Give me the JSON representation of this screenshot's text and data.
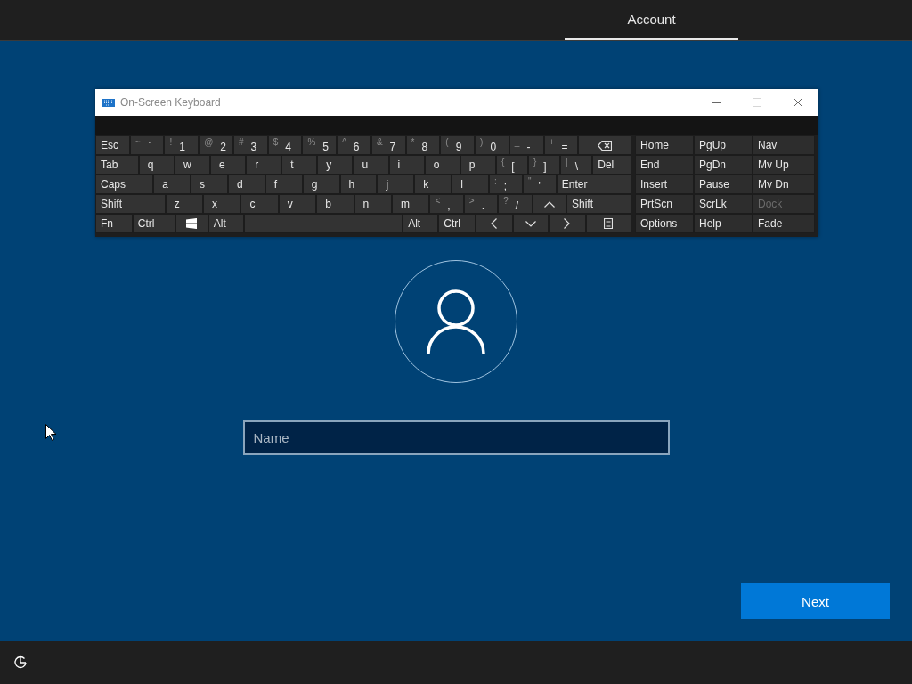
{
  "top_bar": {
    "tabs": [
      {
        "label": "Account",
        "selected": true
      }
    ]
  },
  "keyboard": {
    "title": "On-Screen Keyboard",
    "window_controls": [
      {
        "kind": "minimize",
        "disabled": false
      },
      {
        "kind": "maximize",
        "disabled": true
      },
      {
        "kind": "close",
        "disabled": false
      }
    ],
    "rows": [
      [
        {
          "kind": "key",
          "label": "Esc"
        },
        {
          "kind": "dual",
          "shift": "~",
          "main": "`"
        },
        {
          "kind": "dual",
          "shift": "!",
          "main": "1"
        },
        {
          "kind": "dual",
          "shift": "@",
          "main": "2"
        },
        {
          "kind": "dual",
          "shift": "#",
          "main": "3"
        },
        {
          "kind": "dual",
          "shift": "$",
          "main": "4"
        },
        {
          "kind": "dual",
          "shift": "%",
          "main": "5"
        },
        {
          "kind": "dual",
          "shift": "^",
          "main": "6"
        },
        {
          "kind": "dual",
          "shift": "&",
          "main": "7"
        },
        {
          "kind": "dual",
          "shift": "*",
          "main": "8"
        },
        {
          "kind": "dual",
          "shift": "(",
          "main": "9"
        },
        {
          "kind": "dual",
          "shift": ")",
          "main": "0"
        },
        {
          "kind": "dual",
          "shift": "_",
          "main": "-"
        },
        {
          "kind": "dual",
          "shift": "+",
          "main": "="
        },
        {
          "kind": "backspace"
        }
      ],
      [
        {
          "kind": "tab",
          "label": "Tab"
        },
        {
          "kind": "letter",
          "label": "q"
        },
        {
          "kind": "letter",
          "label": "w"
        },
        {
          "kind": "letter",
          "label": "e"
        },
        {
          "kind": "letter",
          "label": "r"
        },
        {
          "kind": "letter",
          "label": "t"
        },
        {
          "kind": "letter",
          "label": "y"
        },
        {
          "kind": "letter",
          "label": "u"
        },
        {
          "kind": "letter",
          "label": "i"
        },
        {
          "kind": "letter",
          "label": "o"
        },
        {
          "kind": "letter",
          "label": "p"
        },
        {
          "kind": "dual",
          "shift": "{",
          "main": "["
        },
        {
          "kind": "dual",
          "shift": "}",
          "main": "]"
        },
        {
          "kind": "dual",
          "shift": "|",
          "main": "\\"
        },
        {
          "kind": "del",
          "label": "Del"
        }
      ],
      [
        {
          "kind": "caps",
          "label": "Caps"
        },
        {
          "kind": "letter",
          "label": "a"
        },
        {
          "kind": "letter",
          "label": "s"
        },
        {
          "kind": "letter",
          "label": "d"
        },
        {
          "kind": "letter",
          "label": "f"
        },
        {
          "kind": "letter",
          "label": "g"
        },
        {
          "kind": "letter",
          "label": "h"
        },
        {
          "kind": "letter",
          "label": "j"
        },
        {
          "kind": "letter",
          "label": "k"
        },
        {
          "kind": "letter",
          "label": "l"
        },
        {
          "kind": "dual",
          "shift": ":",
          "main": ";"
        },
        {
          "kind": "dual",
          "shift": "\"",
          "main": "'"
        },
        {
          "kind": "enter",
          "label": "Enter"
        }
      ],
      [
        {
          "kind": "lshift",
          "label": "Shift"
        },
        {
          "kind": "letter",
          "label": "z"
        },
        {
          "kind": "letter",
          "label": "x"
        },
        {
          "kind": "letter",
          "label": "c"
        },
        {
          "kind": "letter",
          "label": "v"
        },
        {
          "kind": "letter",
          "label": "b"
        },
        {
          "kind": "letter",
          "label": "n"
        },
        {
          "kind": "letter",
          "label": "m"
        },
        {
          "kind": "dual",
          "shift": "<",
          "main": ","
        },
        {
          "kind": "dual",
          "shift": ">",
          "main": "."
        },
        {
          "kind": "dual",
          "shift": "?",
          "main": "/"
        },
        {
          "kind": "up"
        },
        {
          "kind": "rshift",
          "label": "Shift"
        }
      ],
      [
        {
          "kind": "key",
          "label": "Fn"
        },
        {
          "kind": "ctrl",
          "label": "Ctrl"
        },
        {
          "kind": "win"
        },
        {
          "kind": "alt",
          "label": "Alt"
        },
        {
          "kind": "space"
        },
        {
          "kind": "alt",
          "label": "Alt"
        },
        {
          "kind": "key",
          "label": "Ctrl"
        },
        {
          "kind": "left"
        },
        {
          "kind": "down"
        },
        {
          "kind": "right"
        },
        {
          "kind": "menu"
        }
      ]
    ],
    "nav_rows": [
      [
        {
          "label": "Home",
          "disabled": false
        },
        {
          "label": "PgUp",
          "disabled": false
        },
        {
          "label": "Nav",
          "disabled": false
        }
      ],
      [
        {
          "label": "End",
          "disabled": false
        },
        {
          "label": "PgDn",
          "disabled": false
        },
        {
          "label": "Mv Up",
          "disabled": false
        }
      ],
      [
        {
          "label": "Insert",
          "disabled": false
        },
        {
          "label": "Pause",
          "disabled": false
        },
        {
          "label": "Mv Dn",
          "disabled": false
        }
      ],
      [
        {
          "label": "PrtScn",
          "disabled": false
        },
        {
          "label": "ScrLk",
          "disabled": false
        },
        {
          "label": "Dock",
          "disabled": true
        }
      ],
      [
        {
          "label": "Options",
          "disabled": false
        },
        {
          "label": "Help",
          "disabled": false
        },
        {
          "label": "Fade",
          "disabled": false
        }
      ]
    ]
  },
  "name_field": {
    "placeholder": "Name"
  },
  "next_button": {
    "label": "Next"
  }
}
